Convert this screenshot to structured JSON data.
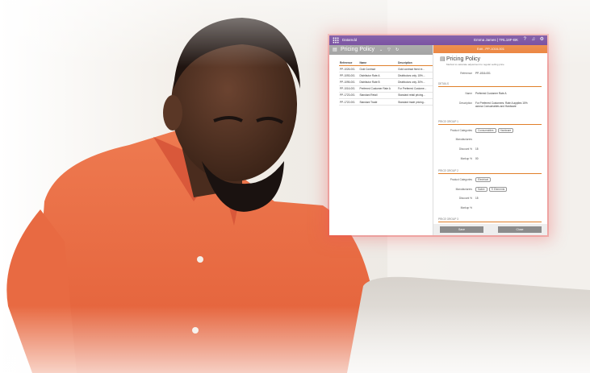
{
  "app": {
    "brand": "Datamdd",
    "user": "Emma James | TRL18F-BK"
  },
  "left": {
    "title": "Pricing Policy",
    "columns": [
      "Reference",
      "Name",
      "Description"
    ],
    "rows": [
      [
        "PP-1026-001",
        "Gold Contract",
        "Gold contract fixed re..."
      ],
      [
        "PP-1093-001",
        "Distributor Rate A",
        "Distributors only. 15%..."
      ],
      [
        "PP-1095-001",
        "Distributor Rate B",
        "Distributors only. 30%..."
      ],
      [
        "PP-1016-001",
        "Preferred Customer Rate A",
        "For Preferred Custome..."
      ],
      [
        "PP-1723-001",
        "Standard Retail",
        "Standard retail pricing..."
      ],
      [
        "PP-1722-001",
        "Standard Trade",
        "Standard trade pricing..."
      ]
    ]
  },
  "right": {
    "header": "Edit - PP-1016-001",
    "title": "Pricing Policy",
    "subtitle": "Method to calculate adjustment to regular selling price",
    "reference_label": "Reference",
    "reference_value": "PP-1016-001",
    "details_label": "DETAILS",
    "name_label": "Name",
    "name_value": "Preferred Customer Rate A",
    "desc_label": "Description",
    "desc_value": "For Preferred Customers. Rate A applies 15% across Consumables and Hardware",
    "group1_label": "PRICE GROUP 1",
    "group2_label": "PRICE GROUP 2",
    "group3_label": "PRICE GROUP 3",
    "pc_label": "Product Categories",
    "manu_label": "Manufacturers",
    "disc_label": "Discount %",
    "markup_label": "Markup %",
    "g1_tags": [
      "Consumables",
      "Hardware"
    ],
    "g1_discount": "15",
    "g1_markup": "00",
    "g2_tags": [
      "Electrical"
    ],
    "g2_manu": [
      "Sabre",
      "Ti Elements"
    ],
    "g2_discount": "15",
    "save": "Save",
    "close": "Close"
  },
  "colors": {
    "purple": "#5d2d8e",
    "orange": "#e9782b",
    "shirt": "#e8683f"
  }
}
